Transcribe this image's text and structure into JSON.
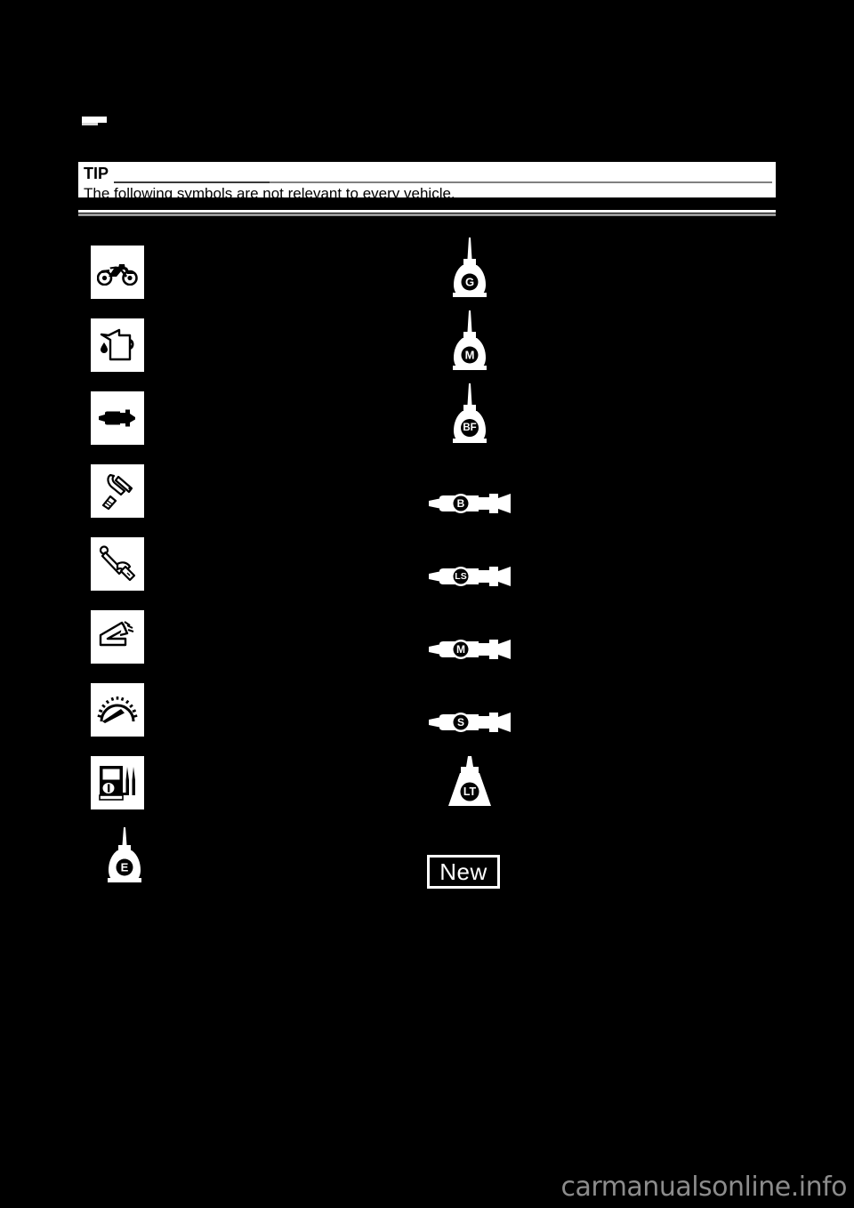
{
  "document": {
    "heading_masked": "",
    "tip": {
      "label": "TIP",
      "body": "The following symbols are not relevant to every vehicle."
    },
    "watermark": "carmanualsonline.info"
  },
  "symbols": {
    "left_column": [
      {
        "id": "vehicle",
        "icon": "motorcycle-icon",
        "letter": "",
        "description": ""
      },
      {
        "id": "fluid-refill",
        "icon": "oil-can-icon",
        "letter": "",
        "description": ""
      },
      {
        "id": "lubricant",
        "icon": "grease-gun-icon",
        "letter": "",
        "description": ""
      },
      {
        "id": "special-tool",
        "icon": "special-tool-icon",
        "letter": "",
        "description": ""
      },
      {
        "id": "tightening",
        "icon": "torque-wrench-icon",
        "letter": "",
        "description": ""
      },
      {
        "id": "wear-limit",
        "icon": "wear-limit-icon",
        "letter": "",
        "description": ""
      },
      {
        "id": "engine-speed",
        "icon": "tachometer-icon",
        "letter": "",
        "description": ""
      },
      {
        "id": "electrical",
        "icon": "multimeter-icon",
        "letter": "",
        "description": ""
      },
      {
        "id": "engine-oil",
        "icon": "oil-bottle-icon",
        "letter": "E",
        "description": ""
      }
    ],
    "right_column": [
      {
        "id": "gear-oil",
        "icon": "oil-bottle-icon",
        "letter": "G",
        "description": ""
      },
      {
        "id": "molybdenum-oil",
        "icon": "oil-bottle-icon",
        "letter": "M",
        "description": ""
      },
      {
        "id": "brake-fluid",
        "icon": "oil-bottle-icon",
        "letter": "BF",
        "description": ""
      },
      {
        "id": "wheel-bearing",
        "icon": "grease-tube-icon",
        "letter": "B",
        "description": ""
      },
      {
        "id": "lithium-soap",
        "icon": "grease-tube-icon",
        "letter": "LS",
        "description": ""
      },
      {
        "id": "molybdenum-grease",
        "icon": "grease-tube-icon",
        "letter": "M",
        "description": ""
      },
      {
        "id": "silicone-grease",
        "icon": "grease-tube-icon",
        "letter": "S",
        "description": ""
      },
      {
        "id": "locking-agent",
        "icon": "locking-agent-icon",
        "letter": "LT",
        "description": ""
      },
      {
        "id": "replace-new",
        "icon": "new-tag",
        "letter": "New",
        "description": ""
      }
    ]
  },
  "colors": {
    "page_background": "#000000",
    "panel_background": "#ffffff",
    "text_on_panel": "#000000",
    "rule": "#808080",
    "watermark": "#8c8c8c"
  }
}
